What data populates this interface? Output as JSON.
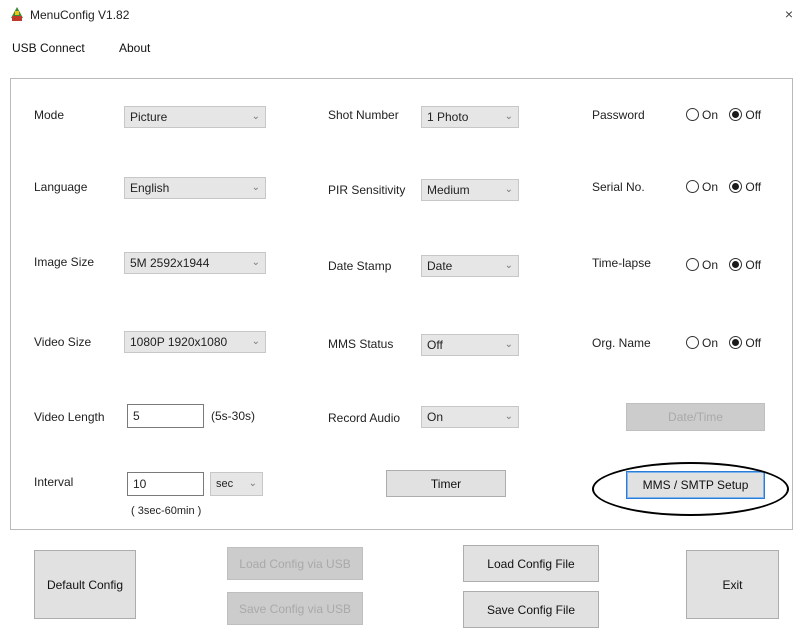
{
  "window": {
    "title": "MenuConfig V1.82",
    "close_glyph": "×",
    "icon": "app-icon"
  },
  "menu": {
    "items": [
      "USB Connect",
      "About"
    ]
  },
  "settings": {
    "mode": {
      "label": "Mode",
      "value": "Picture"
    },
    "language": {
      "label": "Language",
      "value": "English"
    },
    "image_size": {
      "label": "Image Size",
      "value": "5M 2592x1944"
    },
    "video_size": {
      "label": "Video Size",
      "value": "1080P 1920x1080"
    },
    "video_length": {
      "label": "Video Length",
      "value": "5",
      "hint": "(5s-30s)"
    },
    "interval": {
      "label": "Interval",
      "value": "10",
      "unit": "sec",
      "hint": "( 3sec-60min )"
    },
    "shot_number": {
      "label": "Shot Number",
      "value": "1 Photo"
    },
    "pir_sensitivity": {
      "label": "PIR Sensitivity",
      "value": "Medium"
    },
    "date_stamp": {
      "label": "Date Stamp",
      "value": "Date"
    },
    "mms_status": {
      "label": "MMS Status",
      "value": "Off"
    },
    "record_audio": {
      "label": "Record Audio",
      "value": "On"
    },
    "password": {
      "label": "Password",
      "on": "On",
      "off": "Off",
      "selected": "Off"
    },
    "serial_no": {
      "label": "Serial No.",
      "on": "On",
      "off": "Off",
      "selected": "Off"
    },
    "time_lapse": {
      "label": "Time-lapse",
      "on": "On",
      "off": "Off",
      "selected": "Off"
    },
    "org_name": {
      "label": "Org. Name",
      "on": "On",
      "off": "Off",
      "selected": "Off"
    }
  },
  "buttons": {
    "timer": "Timer",
    "date_time": "Date/Time",
    "mms_smtp": "MMS / SMTP Setup",
    "default_config": "Default Config",
    "load_config_usb": "Load Config via USB",
    "save_config_usb": "Save Config via USB",
    "load_config_file": "Load Config File",
    "save_config_file": "Save Config File",
    "exit": "Exit"
  },
  "colors": {
    "focus_border": "#2b7bd9",
    "annotation": "#000000"
  }
}
